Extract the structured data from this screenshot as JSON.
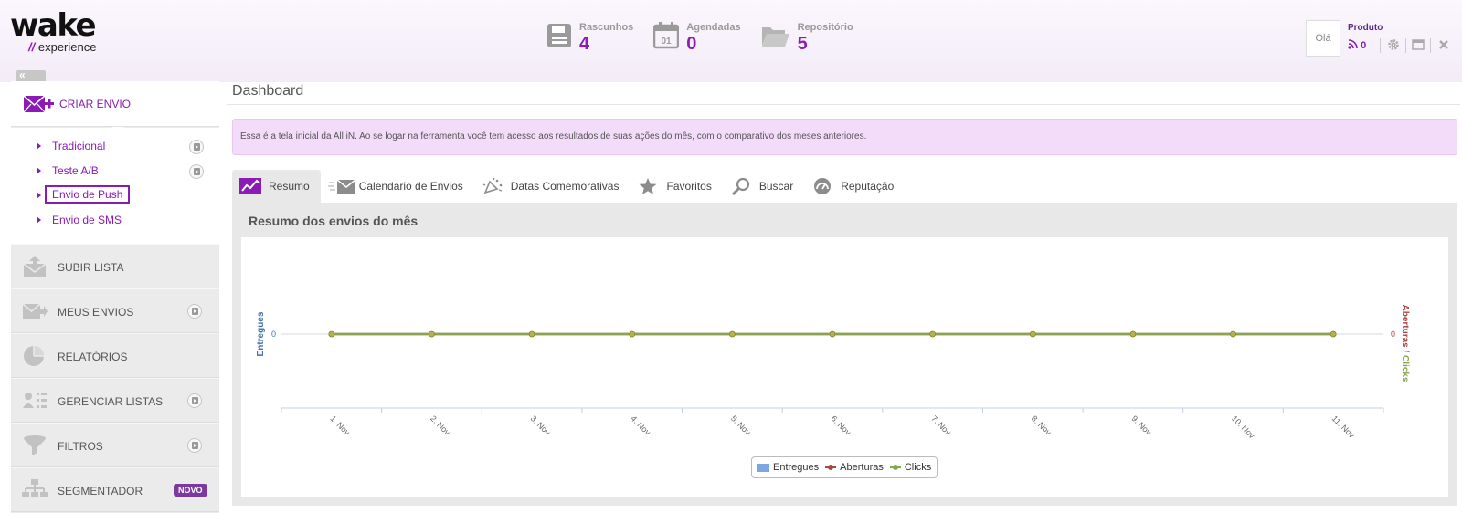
{
  "brand": {
    "name": "wake",
    "slashes": "//",
    "tagline": "experience",
    "accent": "#8a1bb5"
  },
  "header": {
    "stats": [
      {
        "label": "Rascunhos",
        "value": "4",
        "icon": "floppy-disk-icon"
      },
      {
        "label": "Agendadas",
        "value": "0",
        "icon": "calendar-icon",
        "icon_text": "01"
      },
      {
        "label": "Repositório",
        "value": "5",
        "icon": "folder-icon"
      }
    ],
    "greeting": "Olá",
    "user_product": "Produto",
    "feed_count": "0",
    "tools": [
      "gear-icon",
      "layout-icon",
      "close-icon"
    ]
  },
  "sidebar": {
    "collapse_label": "«",
    "active": {
      "label": "CRIAR ENVIO",
      "icon": "envelope-plus-icon"
    },
    "sub_items": [
      {
        "label": "Tradicional",
        "has_play": true
      },
      {
        "label": "Teste A/B",
        "has_play": true
      },
      {
        "label": "Envio de Push",
        "has_play": false,
        "highlighted": true
      },
      {
        "label": "Envio de SMS",
        "has_play": false
      }
    ],
    "items": [
      {
        "label": "SUBIR LISTA",
        "icon": "upload-list-icon",
        "has_play": false
      },
      {
        "label": "MEUS ENVIOS",
        "icon": "my-sends-icon",
        "has_play": true
      },
      {
        "label": "RELATÓRIOS",
        "icon": "pie-chart-icon",
        "has_play": false
      },
      {
        "label": "GERENCIAR LISTAS",
        "icon": "manage-lists-icon",
        "has_play": true
      },
      {
        "label": "FILTROS",
        "icon": "funnel-icon",
        "has_play": true
      },
      {
        "label": "SEGMENTADOR",
        "icon": "segmenter-icon",
        "has_play": false,
        "badge": "NOVO"
      }
    ]
  },
  "main": {
    "title": "Dashboard",
    "info": "Essa é a tela inicial da All iN. Ao se logar na ferramenta você tem acesso aos resultados de suas ações do mês, com o comparativo dos meses anteriores.",
    "tabs": [
      {
        "label": "Resumo",
        "active": true,
        "icon": "trend-chart-icon"
      },
      {
        "label": "Calendario de Envios",
        "icon": "flying-envelope-icon"
      },
      {
        "label": "Datas Comemorativas",
        "icon": "celebration-icon"
      },
      {
        "label": "Favoritos",
        "icon": "star-icon"
      },
      {
        "label": "Buscar",
        "icon": "search-icon"
      },
      {
        "label": "Reputação",
        "icon": "reputation-gauge-icon"
      }
    ],
    "panel_title": "Resumo dos envios do mês"
  },
  "chart_data": {
    "type": "line",
    "categories": [
      "1. Nov",
      "2. Nov",
      "3. Nov",
      "4. Nov",
      "5. Nov",
      "6. Nov",
      "7. Nov",
      "8. Nov",
      "9. Nov",
      "10. Nov",
      "11. Nov"
    ],
    "series": [
      {
        "name": "Entregues",
        "kind": "column",
        "axis": "left",
        "color": "#7ca7e0",
        "values": [
          0,
          0,
          0,
          0,
          0,
          0,
          0,
          0,
          0,
          0,
          0
        ]
      },
      {
        "name": "Aberturas",
        "kind": "line",
        "axis": "right",
        "color": "#aa4643",
        "values": [
          0,
          0,
          0,
          0,
          0,
          0,
          0,
          0,
          0,
          0,
          0
        ]
      },
      {
        "name": "Clicks",
        "kind": "line",
        "axis": "right",
        "color": "#89a54e",
        "values": [
          0,
          0,
          0,
          0,
          0,
          0,
          0,
          0,
          0,
          0,
          0
        ]
      }
    ],
    "ylabel_left": "Entregues",
    "ylabel_right": {
      "parts": [
        "Aberturas",
        "/",
        "Clicks"
      ],
      "colors": [
        "#aa4643",
        "#888888",
        "#89a54e"
      ]
    },
    "y_ticks_left": [
      "0"
    ],
    "y_ticks_right": [
      "0"
    ],
    "ylabel_left_color": "#4572a7",
    "legend": "bottom-center",
    "grid": false
  }
}
